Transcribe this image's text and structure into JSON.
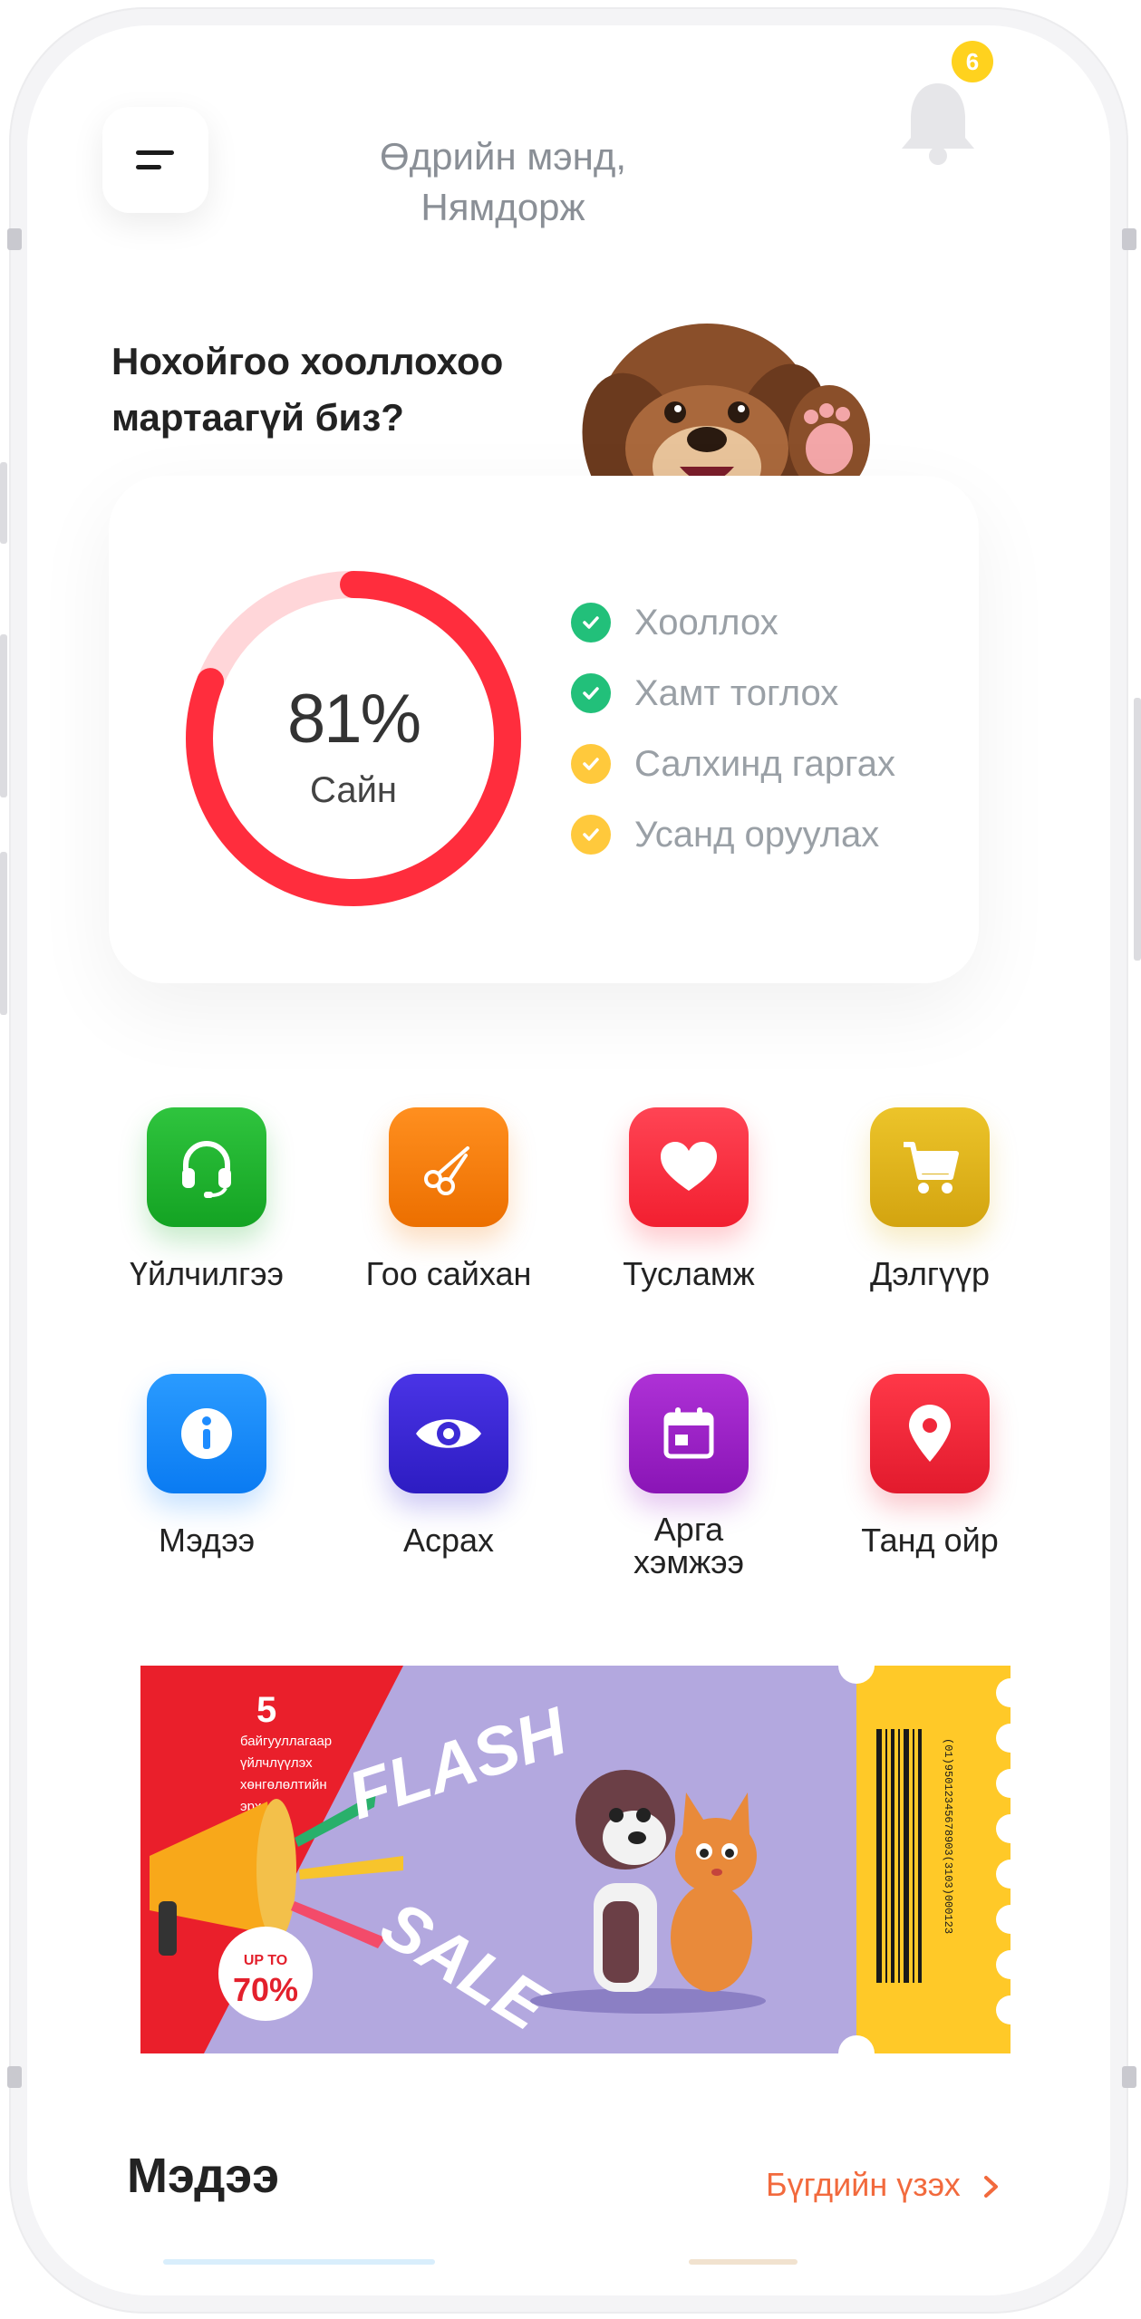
{
  "header": {
    "greeting_line1": "Өдрийн мэнд,",
    "greeting_line2": "Нямдорж",
    "notification_count": "6"
  },
  "colors": {
    "accent": "#ff2d3d",
    "accent_light": "#ffd6d9",
    "check_done": "#22c07a",
    "check_pending": "#ffc93c",
    "link": "#f26a3d"
  },
  "reminder": {
    "line1": "Нохойгоо хооллохоо",
    "line2": "мартаагүй биз?"
  },
  "progress": {
    "percent_text": "81%",
    "status": "Сайн",
    "value": 0.81
  },
  "tasks": [
    {
      "label": "Хооллох",
      "state": "done"
    },
    {
      "label": "Хамт тоглох",
      "state": "done"
    },
    {
      "label": "Салхинд гаргах",
      "state": "pending"
    },
    {
      "label": "Усанд оруулах",
      "state": "pending"
    }
  ],
  "menu": [
    {
      "label": "Үйлчилгээ",
      "icon": "headset-icon",
      "color": "#1fb12f"
    },
    {
      "label": "Гоо сайхан",
      "icon": "scissors-icon",
      "color": "#f57d0b"
    },
    {
      "label": "Тусламж",
      "icon": "heart-icon",
      "color": "#ff3140"
    },
    {
      "label": "Дэлгүүр",
      "icon": "cart-icon",
      "color": "#e0b51c"
    },
    {
      "label": "Мэдээ",
      "icon": "info-icon",
      "color": "#1e8cff"
    },
    {
      "label": "Асрах",
      "icon": "eye-icon",
      "color": "#3c2ad6"
    },
    {
      "label_line1": "Арга",
      "label_line2": "хэмжээ",
      "icon": "calendar-icon",
      "color": "#9c22c7"
    },
    {
      "label": "Танд ойр",
      "icon": "location-pin-icon",
      "color": "#f0283a"
    }
  ],
  "banner": {
    "number": "5",
    "promo_text_line1": "байгууллагаар",
    "promo_text_line2": "үйлчлүүлэх",
    "promo_text_line3": "хөнгөлөлтийн",
    "promo_text_line4": "эрх",
    "flash_word1": "FLASH",
    "flash_word2": "SALE",
    "upto": "UP TO",
    "discount": "70%",
    "barcode_text": "(01)95012345678903(3103)000123"
  },
  "news": {
    "title": "Мэдээ",
    "see_all": "Бүгдийн үзэх"
  }
}
